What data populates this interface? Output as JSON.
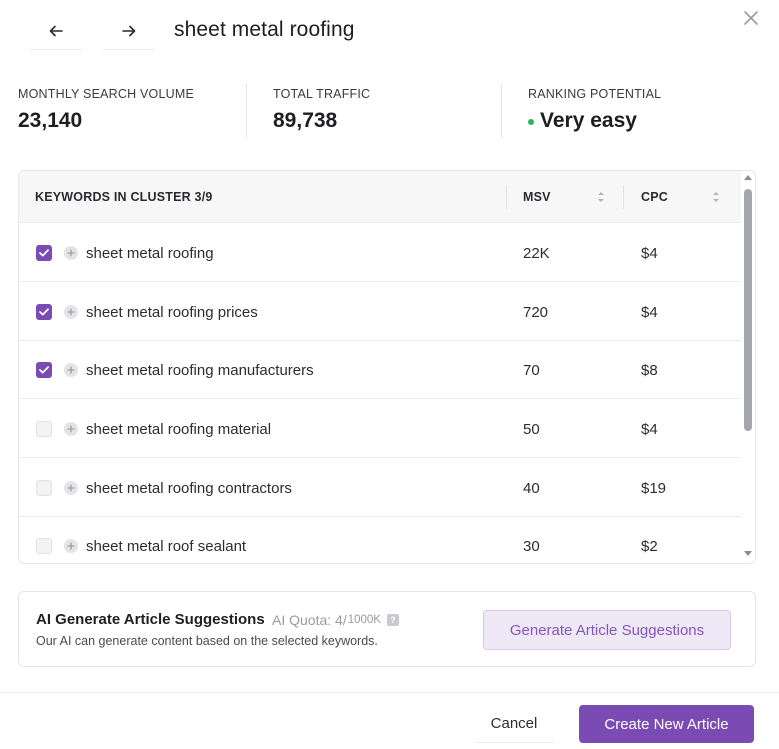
{
  "header": {
    "title": "sheet metal roofing",
    "back_icon": "arrow-left-icon",
    "forward_icon": "arrow-right-icon",
    "close_icon": "close-icon"
  },
  "stats": [
    {
      "label": "MONTHLY SEARCH VOLUME",
      "value": "23,140"
    },
    {
      "label": "TOTAL TRAFFIC",
      "value": "89,738"
    },
    {
      "label": "RANKING POTENTIAL",
      "value": "Very easy",
      "indicator_color": "#2fb35a"
    }
  ],
  "table": {
    "headers": {
      "keyword": "KEYWORDS IN CLUSTER 3/9",
      "msv": "MSV",
      "cpc": "CPC"
    },
    "rows": [
      {
        "keyword": "sheet metal roofing",
        "msv": "22K",
        "cpc": "$4",
        "checked": true
      },
      {
        "keyword": "sheet metal roofing prices",
        "msv": "720",
        "cpc": "$4",
        "checked": true
      },
      {
        "keyword": "sheet metal roofing manufacturers",
        "msv": "70",
        "cpc": "$8",
        "checked": true
      },
      {
        "keyword": "sheet metal roofing material",
        "msv": "50",
        "cpc": "$4",
        "checked": false
      },
      {
        "keyword": "sheet metal roofing contractors",
        "msv": "40",
        "cpc": "$19",
        "checked": false
      },
      {
        "keyword": "sheet metal roof sealant",
        "msv": "30",
        "cpc": "$2",
        "checked": false
      }
    ]
  },
  "ai": {
    "title": "AI Generate Article Suggestions",
    "quota_prefix": "AI Quota: 4/",
    "quota_total": "1000K",
    "description": "Our AI can generate content based on the selected keywords.",
    "generate_label": "Generate Article Suggestions"
  },
  "footer": {
    "cancel_label": "Cancel",
    "create_label": "Create New Article"
  },
  "colors": {
    "accent": "#7a4bb3",
    "accent_light": "#efe8f7",
    "success": "#2fb35a"
  }
}
